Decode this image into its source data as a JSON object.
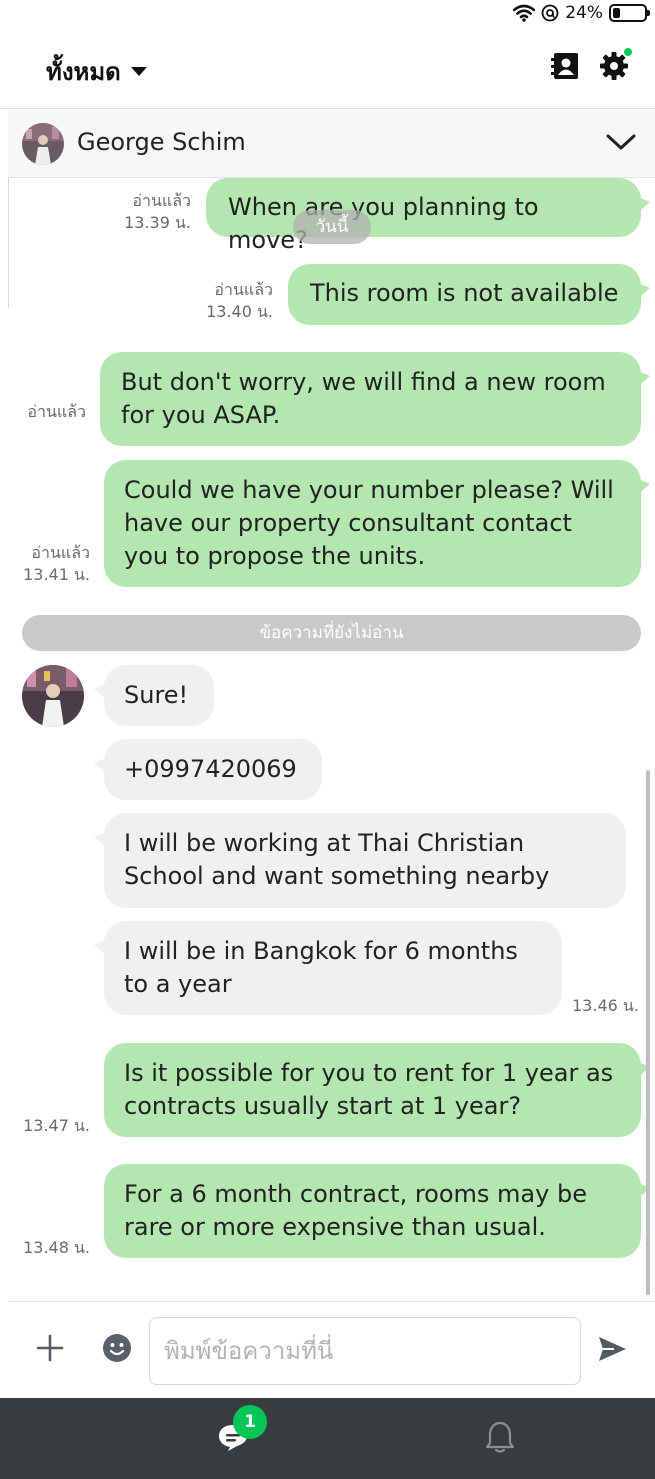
{
  "status_bar": {
    "battery": "24%",
    "battery_level": 0.24
  },
  "header": {
    "filter_label": "ทั้งหมด"
  },
  "chat": {
    "contact_name": "George Schim"
  },
  "date_separator": "วันนี้",
  "unread_divider": "ข้อความที่ยังไม่อ่าน",
  "messages": [
    {
      "direction": "out",
      "lines": [
        "When are you planning to move?"
      ],
      "read": "อ่านแล้ว",
      "time": "13.39 น."
    },
    {
      "direction": "out",
      "lines": [
        "This room is not available"
      ],
      "read": "อ่านแล้ว",
      "time": "13.40 น."
    },
    {
      "direction": "out",
      "lines": [
        "But don't worry, we will find a new room",
        "for you ASAP."
      ],
      "read": "อ่านแล้ว",
      "time": ""
    },
    {
      "direction": "out",
      "lines": [
        "Could we have your number please? Will",
        "have our property consultant contact",
        "you to propose the units."
      ],
      "read": "อ่านแล้ว",
      "time": "13.41 น."
    },
    {
      "direction": "in",
      "lines": [
        "Sure!"
      ],
      "read": "",
      "time": ""
    },
    {
      "direction": "in",
      "lines": [
        "+0997420069"
      ],
      "read": "",
      "time": ""
    },
    {
      "direction": "in",
      "lines": [
        "I will be working at Thai Christian",
        "School and want something nearby"
      ],
      "read": "",
      "time": ""
    },
    {
      "direction": "in",
      "lines": [
        "I will be in Bangkok for 6 months",
        "to a year"
      ],
      "read": "",
      "time": "13.46 น."
    },
    {
      "direction": "out",
      "lines": [
        "Is it possible for you to rent for 1 year as",
        "contracts usually start at 1 year?"
      ],
      "read": "",
      "time": "13.47 น."
    },
    {
      "direction": "out",
      "lines": [
        "For a 6 month contract, rooms may be",
        "rare or more expensive than usual."
      ],
      "read": "",
      "time": "13.48 น."
    }
  ],
  "composer": {
    "placeholder": "พิมพ์ข้อความที่นี่"
  },
  "bottom_nav": {
    "chat_badge": "1"
  },
  "colors": {
    "outgoing_bubble": "#b4e6b0",
    "incoming_bubble": "#f0f0f2",
    "accent_green": "#06c755",
    "nav_background": "#383c40"
  },
  "icons": [
    "wifi-icon",
    "location-lock-icon",
    "battery-icon",
    "contacts-icon",
    "gear-icon",
    "chevron-down-icon",
    "plus-icon",
    "emoji-icon",
    "send-icon",
    "chat-icon",
    "bell-icon"
  ]
}
